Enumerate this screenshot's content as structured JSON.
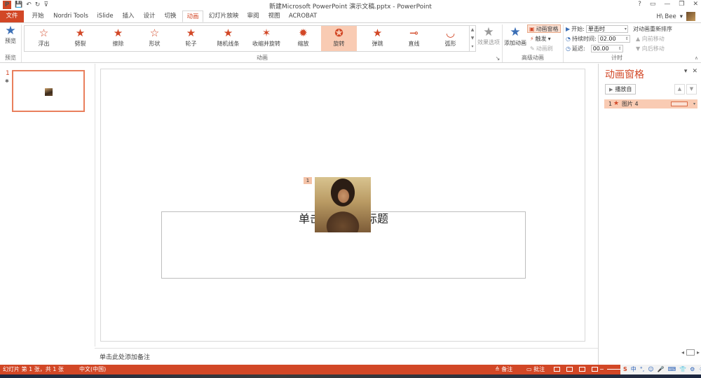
{
  "window": {
    "title": "新建Microsoft PowerPoint 演示文稿.pptx - PowerPoint",
    "help": "?",
    "controls": [
      "▭",
      "—",
      "❐",
      "✕"
    ]
  },
  "quick_access": {
    "logo": "P",
    "save": "💾",
    "undo": "↶",
    "redo": "↻",
    "customize": "⊽"
  },
  "tabs": [
    {
      "label": "文件"
    },
    {
      "label": "开始"
    },
    {
      "label": "Nordri Tools"
    },
    {
      "label": "iSlide"
    },
    {
      "label": "插入"
    },
    {
      "label": "设计"
    },
    {
      "label": "切换"
    },
    {
      "label": "动画"
    },
    {
      "label": "幻灯片放映"
    },
    {
      "label": "审阅"
    },
    {
      "label": "视图"
    },
    {
      "label": "ACROBAT"
    }
  ],
  "user": {
    "name": "H\\ Bee",
    "dropdown": "▾"
  },
  "ribbon": {
    "preview": {
      "label": "预览",
      "group_label": "预览"
    },
    "animations": [
      {
        "label": "浮出",
        "icon": "☆"
      },
      {
        "label": "劈裂",
        "icon": "★"
      },
      {
        "label": "擦除",
        "icon": "★"
      },
      {
        "label": "形状",
        "icon": "☆"
      },
      {
        "label": "轮子",
        "icon": "★"
      },
      {
        "label": "随机线条",
        "icon": "★"
      },
      {
        "label": "收缩并旋转",
        "icon": "✶"
      },
      {
        "label": "缩放",
        "icon": "✹"
      },
      {
        "label": "旋转",
        "icon": "✪"
      },
      {
        "label": "弹跳",
        "icon": "★"
      },
      {
        "label": "直线",
        "icon": "⊸"
      },
      {
        "label": "弧形",
        "icon": "◡"
      }
    ],
    "selected_animation": "旋转",
    "animation_group_label": "动画",
    "effect_options": "效果选项",
    "add_animation": "添加动画",
    "animation_pane_btn": "动画窗格",
    "trigger_btn": "触发",
    "painter_btn": "动画刷",
    "advanced_group_label": "高级动画",
    "timing": {
      "start_label": "开始:",
      "start_value": "单击时",
      "duration_label": "持续时间:",
      "duration_value": "02.00",
      "delay_label": "延迟:",
      "delay_value": "00.00",
      "reorder_title": "对动画重新排序",
      "move_earlier": "向前移动",
      "move_later": "向后移动",
      "group_label": "计时"
    }
  },
  "thumbnails": [
    {
      "number": "1",
      "star": "✱"
    }
  ],
  "slide": {
    "title_placeholder": "单击此处添加标题",
    "animation_tag": "1"
  },
  "notes_placeholder": "单击此处添加备注",
  "animation_pane": {
    "title": "动画窗格",
    "dropdown": "▾",
    "close": "✕",
    "play_from": "播放自",
    "items": [
      {
        "number": "1",
        "name": "图片 4"
      }
    ]
  },
  "status": {
    "slide_info": "幻灯片 第 1 张，共 1 张",
    "language": "中文(中国)",
    "notes": "备注",
    "comments": "批注"
  },
  "ime": {
    "logo": "S",
    "items": [
      "中",
      "°,",
      "☺",
      "🎤",
      "⌨",
      "👕",
      "⚙",
      "⁘"
    ]
  }
}
